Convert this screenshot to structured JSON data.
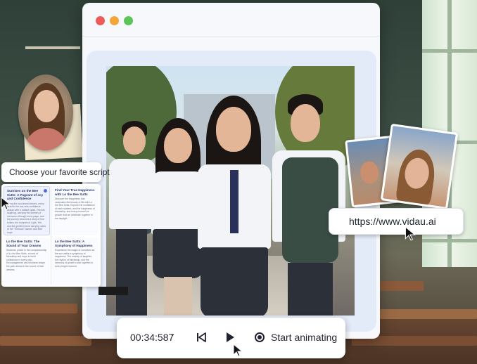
{
  "window": {
    "controls": [
      "close",
      "minimize",
      "maximize"
    ]
  },
  "script_panel": {
    "title": "Choose your favorite script",
    "cards": [
      {
        "title": "Sunrises on the Bee Sutts: A Pageant of Joy and Confidence",
        "body": "Along the sun-kissed shores, every heart in the bus sets confidence ablaze with a radiant spark. Friends laughing, carrying the warmth of memories through every page, and the journey becomes a story of true smiles, the footprint of Light, Yeh, and the gentle breeze carrying notes of the \"Girlhood\" banner and their hope."
      },
      {
        "title": "Find Your True Happiness with Lo the Bee Sutts",
        "body": "Discover the Happiness that celebrates the beauty of life with Lo the Bee Sutts. Explore the confidence of each student, and the happiness of friendship, and every moment of growth that we celebrate together in the daylight."
      },
      {
        "title": "Lo the Bee Sutts: The Sound of Your Dreams",
        "body": "Students, joined in the companionship of Lo the Bee Sutts, a bond of friendship and hope to build confidence in every step. Encouragement and kindness shape the path ahead in the sound of their dreams."
      },
      {
        "title": "Lo the Bee Sutts: A Symphony of Happiness",
        "body": "Experience the magic of ourselves as the sun walks a symphony of happiness. The melody of laughter, the rhythm of friendship, and the harmony of growth come together in every bright moment."
      }
    ]
  },
  "url_chip": {
    "text": "https://www.vidau.ai"
  },
  "player": {
    "time": "00:34:587",
    "time_chevron": "⌄",
    "start_label": "Start animating"
  },
  "icons": {
    "prev": "skip-previous-icon",
    "play": "play-icon",
    "record": "record-icon",
    "cursor": "pointer-cursor-icon"
  },
  "colors": {
    "close": "#ef5a5a",
    "minimize": "#f3a73b",
    "maximize": "#5cc55a",
    "accent": "#4a6cf0"
  }
}
